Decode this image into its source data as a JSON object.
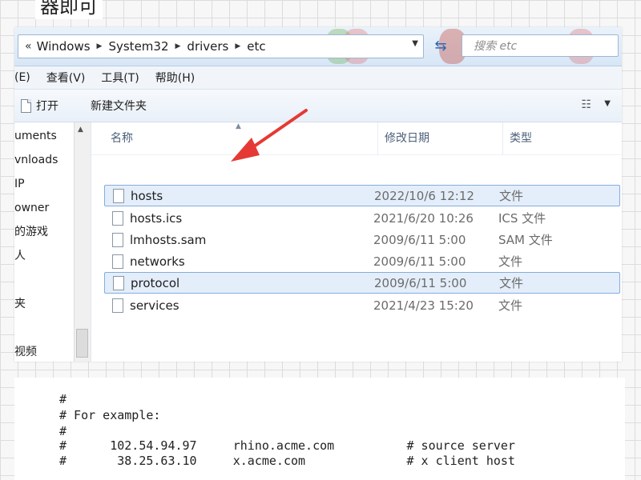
{
  "caption": "器即可",
  "address_bar": {
    "prefix": "«",
    "breadcrumbs": [
      "Windows",
      "System32",
      "drivers",
      "etc"
    ],
    "search_placeholder": "搜索 etc"
  },
  "menu": [
    "(E)",
    "查看(V)",
    "工具(T)",
    "帮助(H)"
  ],
  "toolbar": {
    "open_label": "打开",
    "new_folder_label": "新建文件夹"
  },
  "nav_pane": [
    "uments",
    "vnloads",
    "IP",
    "owner",
    "的游戏",
    "人",
    "",
    "夹",
    "",
    "视频"
  ],
  "columns": {
    "name": "名称",
    "date": "修改日期",
    "type": "类型"
  },
  "files": [
    {
      "name": "hosts",
      "date": "2022/10/6 12:12",
      "type": "文件",
      "selected": true
    },
    {
      "name": "hosts.ics",
      "date": "2021/6/20 10:26",
      "type": "ICS 文件",
      "selected": false
    },
    {
      "name": "lmhosts.sam",
      "date": "2009/6/11 5:00",
      "type": "SAM 文件",
      "selected": false
    },
    {
      "name": "networks",
      "date": "2009/6/11 5:00",
      "type": "文件",
      "selected": false
    },
    {
      "name": "protocol",
      "date": "2009/6/11 5:00",
      "type": "文件",
      "selected": true
    },
    {
      "name": "services",
      "date": "2021/4/23 15:20",
      "type": "文件",
      "selected": false
    }
  ],
  "hosts_text": [
    "#",
    "# For example:",
    "#",
    "#      102.54.94.97     rhino.acme.com          # source server",
    "#       38.25.63.10     x.acme.com              # x client host"
  ],
  "colors": {
    "accent": "#84acdd",
    "arrow": "#e53935"
  }
}
